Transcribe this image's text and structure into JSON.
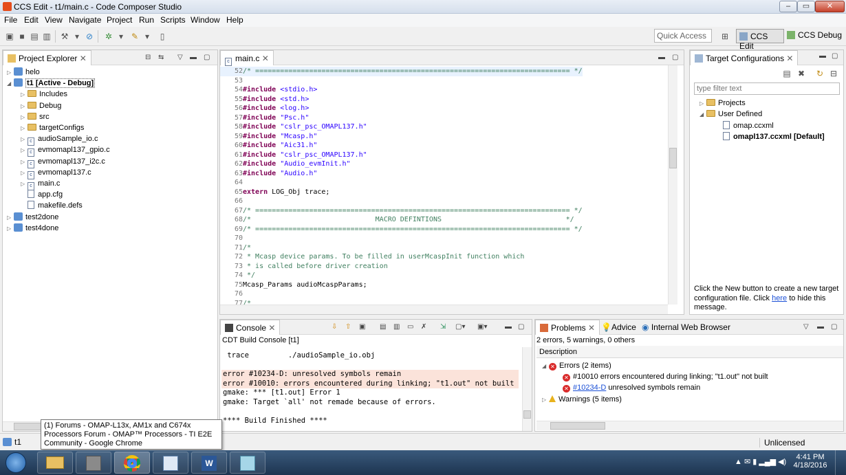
{
  "window": {
    "title": "CCS Edit - t1/main.c - Code Composer Studio",
    "minimize": "–",
    "maximize": "▭",
    "close": "✕"
  },
  "menubar": {
    "items": [
      "File",
      "Edit",
      "View",
      "Navigate",
      "Project",
      "Run",
      "Scripts",
      "Window",
      "Help"
    ]
  },
  "toolbar": {
    "quick_access_placeholder": "Quick Access",
    "perspectives": [
      "CCS Edit",
      "CCS Debug"
    ]
  },
  "project_explorer": {
    "tab_label": "Project Explorer",
    "items": [
      {
        "label": "helo",
        "type": "project",
        "expanded": false,
        "indent": 0
      },
      {
        "label": "t1  [Active - Debug]",
        "type": "project",
        "expanded": true,
        "indent": 0,
        "bold": true
      },
      {
        "label": "Includes",
        "type": "includes",
        "expanded": false,
        "indent": 1
      },
      {
        "label": "Debug",
        "type": "folder",
        "expanded": false,
        "indent": 1
      },
      {
        "label": "src",
        "type": "folder",
        "expanded": false,
        "indent": 1
      },
      {
        "label": "targetConfigs",
        "type": "folder",
        "expanded": false,
        "indent": 1
      },
      {
        "label": "audioSample_io.c",
        "type": "c",
        "expanded": false,
        "indent": 1
      },
      {
        "label": "evmomapl137_gpio.c",
        "type": "c",
        "expanded": false,
        "indent": 1
      },
      {
        "label": "evmomapl137_i2c.c",
        "type": "c",
        "expanded": false,
        "indent": 1
      },
      {
        "label": "evmomapl137.c",
        "type": "c",
        "expanded": false,
        "indent": 1
      },
      {
        "label": "main.c",
        "type": "c",
        "expanded": false,
        "indent": 1
      },
      {
        "label": "app.cfg",
        "type": "cfg",
        "expanded": null,
        "indent": 1
      },
      {
        "label": "makefile.defs",
        "type": "file",
        "expanded": null,
        "indent": 1
      },
      {
        "label": "test2done",
        "type": "project",
        "expanded": false,
        "indent": 0
      },
      {
        "label": "test4done",
        "type": "project",
        "expanded": false,
        "indent": 0
      }
    ]
  },
  "editor": {
    "tab_label": "main.c",
    "lines": [
      {
        "n": "52",
        "t": "/* ============================================================================ */",
        "k": "cm"
      },
      {
        "n": "53",
        "t": "",
        "k": ""
      },
      {
        "n": "54",
        "t": "#include <stdio.h>",
        "k": "inc"
      },
      {
        "n": "55",
        "t": "#include <std.h>",
        "k": "inc"
      },
      {
        "n": "56",
        "t": "#include <log.h>",
        "k": "inc"
      },
      {
        "n": "57",
        "t": "#include \"Psc.h\"",
        "k": "inc"
      },
      {
        "n": "58",
        "t": "#include \"cslr_psc_OMAPL137.h\"",
        "k": "inc"
      },
      {
        "n": "59",
        "t": "#include \"Mcasp.h\"",
        "k": "inc"
      },
      {
        "n": "60",
        "t": "#include \"Aic31.h\"",
        "k": "inc"
      },
      {
        "n": "61",
        "t": "#include \"cslr_psc_OMAPL137.h\"",
        "k": "inc"
      },
      {
        "n": "62",
        "t": "#include \"Audio_evmInit.h\"",
        "k": "inc"
      },
      {
        "n": "63",
        "t": "#include \"Audio.h\"",
        "k": "inc"
      },
      {
        "n": "64",
        "t": "",
        "k": ""
      },
      {
        "n": "65",
        "t": "extern LOG_Obj trace;",
        "k": "ext"
      },
      {
        "n": "66",
        "t": "",
        "k": ""
      },
      {
        "n": "67",
        "t": "/* ============================================================================ */",
        "k": "cm"
      },
      {
        "n": "68",
        "t": "/*                              MACRO DEFINTIONS                              */",
        "k": "cm"
      },
      {
        "n": "69",
        "t": "/* ============================================================================ */",
        "k": "cm"
      },
      {
        "n": "70",
        "t": "",
        "k": ""
      },
      {
        "n": "71",
        "t": "/*",
        "k": "cm"
      },
      {
        "n": "72",
        "t": " * Mcasp device params. To be filled in userMcaspInit function which",
        "k": "cm"
      },
      {
        "n": "73",
        "t": " * is called before driver creation",
        "k": "cm"
      },
      {
        "n": "74",
        "t": " */",
        "k": "cm"
      },
      {
        "n": "75",
        "t": "Mcasp_Params audioMcaspParams;",
        "k": ""
      },
      {
        "n": "76",
        "t": "",
        "k": ""
      },
      {
        "n": "77",
        "t": "/*",
        "k": "cm"
      }
    ]
  },
  "target_config": {
    "tab_label": "Target Configurations",
    "filter_placeholder": "type filter text",
    "items": [
      {
        "label": "Projects",
        "indent": 0,
        "arrow": "▷",
        "icon": "folder"
      },
      {
        "label": "User Defined",
        "indent": 0,
        "arrow": "◢",
        "icon": "folder"
      },
      {
        "label": "omap.ccxml",
        "indent": 1,
        "arrow": "",
        "icon": "file"
      },
      {
        "label": "omapl137.ccxml [Default]",
        "indent": 1,
        "arrow": "",
        "icon": "file",
        "bold": true
      }
    ],
    "help_text_1": "Click the New button to create a new target configuration file. Click ",
    "help_link": "here",
    "help_text_2": " to hide this message."
  },
  "console": {
    "tab_label": "Console",
    "subtitle": "CDT Build Console [t1]",
    "lines": [
      {
        "t": " trace         ./audioSample_io.obj",
        "err": false
      },
      {
        "t": "",
        "err": false
      },
      {
        "t": "error #10234-D: unresolved symbols remain",
        "err": true
      },
      {
        "t": "error #10010: errors encountered during linking; \"t1.out\" not built",
        "err": true
      },
      {
        "t": "gmake: *** [t1.out] Error 1",
        "err": false
      },
      {
        "t": "gmake: Target `all' not remade because of errors.",
        "err": false
      },
      {
        "t": "",
        "err": false
      },
      {
        "t": "**** Build Finished ****",
        "err": false
      }
    ]
  },
  "problems": {
    "tabs": [
      "Problems",
      "Advice",
      "Internal Web Browser"
    ],
    "summary": "2 errors, 5 warnings, 0 others",
    "column_header": "Description",
    "errors_group": "Errors (2 items)",
    "error_1": "#10010 errors encountered during linking; \"t1.out\" not built",
    "error_2_link": "#10234-D",
    "error_2_text": " unresolved symbols remain",
    "warnings_group": "Warnings (5 items)"
  },
  "statusbar": {
    "project": "t1",
    "license": "Unlicensed"
  },
  "tooltip": {
    "text": "(1) Forums - OMAP-L13x, AM1x and C674x Processors Forum - OMAP™ Processors - TI E2E Community - Google Chrome"
  },
  "taskbar": {
    "time": "4:41 PM",
    "date": "4/18/2016",
    "apps": [
      "file-explorer",
      "virtualbox",
      "chrome",
      "paint",
      "word",
      "notepad"
    ]
  },
  "colors": {
    "keyword": "#7f0055",
    "string": "#2a00ff",
    "comment": "#3f7f5f",
    "error_bg": "#fbe3da",
    "taskbar": "#1d3450"
  }
}
